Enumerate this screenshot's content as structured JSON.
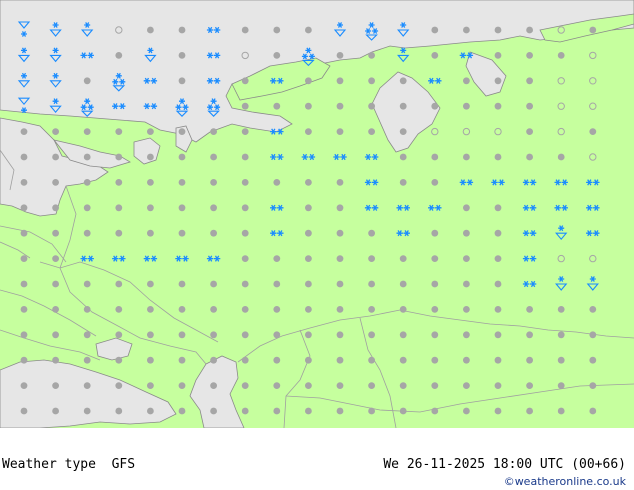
{
  "footer": {
    "title": "Weather type  GFS",
    "valid_time": "We 26-11-2025 18:00 UTC (00+66)",
    "credit": "©weatheronline.co.uk"
  },
  "colors": {
    "land": "#c6ff9e",
    "sea": "#e6e6e6",
    "border": "#a0a0a0",
    "coast": "#8a8a8a",
    "dot": "#a6a6a6",
    "snow": "#1a8cff"
  },
  "legend_symbols": {
    "dry": "grey-dot",
    "light-snow": "snow-double-asterisk",
    "snow-showers": "snow-shower-glyph",
    "heavy-snow": "snow-triple-asterisk"
  },
  "grid": {
    "rows": [
      "sSS.ddadddStSdddd.d",
      "SSadSda.dtddSdaddd.",
      "SSdtadadaddddaddd..",
      "sStaattdddddddddd..",
      "ddddddddadddd...d.d",
      "ddddddddaaaadddddd.",
      "dddddddddddaddaaaaa",
      "ddddddddaddaaaddaaa",
      "ddddddddadddadddaSa",
      "ddaaaaaddddddddda..",
      "ddddddddddddddddaSS",
      "ddddddddddddddddddd",
      "ddddddddddddddddddd",
      "ddddddddddddddddddd",
      "ddddddddddddddddddd",
      "ddddddddddddddddddd",
      "ddddddddddddddddddd"
    ],
    "key": {
      "d": "dry",
      ".": "dry-open",
      "a": "light-snow",
      "t": "snow-showers",
      "s": "snow-shower-dot",
      "S": "snow-shower-open"
    }
  }
}
